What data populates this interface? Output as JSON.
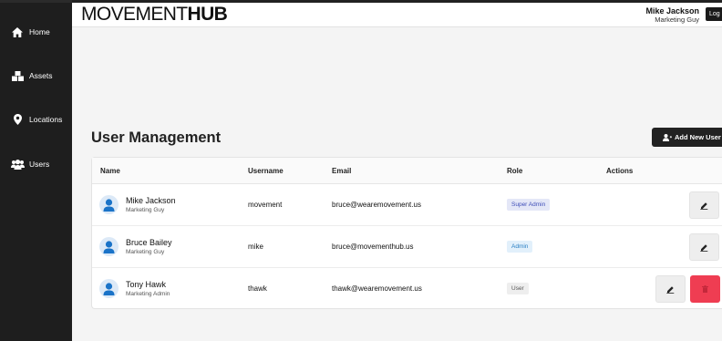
{
  "sidebar": {
    "items": [
      {
        "label": "Home",
        "icon": "home-icon"
      },
      {
        "label": "Assets",
        "icon": "boxes-icon"
      },
      {
        "label": "Locations",
        "icon": "map-pin-icon"
      },
      {
        "label": "Users",
        "icon": "users-icon"
      }
    ]
  },
  "header": {
    "logo_thin": "MOVEMENT",
    "logo_bold": "HUB",
    "user_name": "Mike Jackson",
    "user_role": "Marketing Guy",
    "logout_label": "Log"
  },
  "main": {
    "title": "User Management",
    "add_button": "Add New User",
    "columns": [
      "Name",
      "Username",
      "Email",
      "Role",
      "Actions"
    ],
    "rows": [
      {
        "name": "Mike Jackson",
        "title": "Marketing Guy",
        "username": "movement",
        "email": "bruce@wearemovement.us",
        "role": "Super Admin"
      },
      {
        "name": "Bruce Bailey",
        "title": "Marketing Guy",
        "username": "mike",
        "email": "bruce@movementhub.us",
        "role": "Admin"
      },
      {
        "name": "Tony Hawk",
        "title": "Marketing Admin",
        "username": "thawk",
        "email": "thawk@wearemovement.us",
        "role": "User"
      }
    ]
  },
  "colors": {
    "sidebar": "#1e1e1e",
    "delete": "#ef3d52",
    "avatar": "#1a73c8"
  }
}
